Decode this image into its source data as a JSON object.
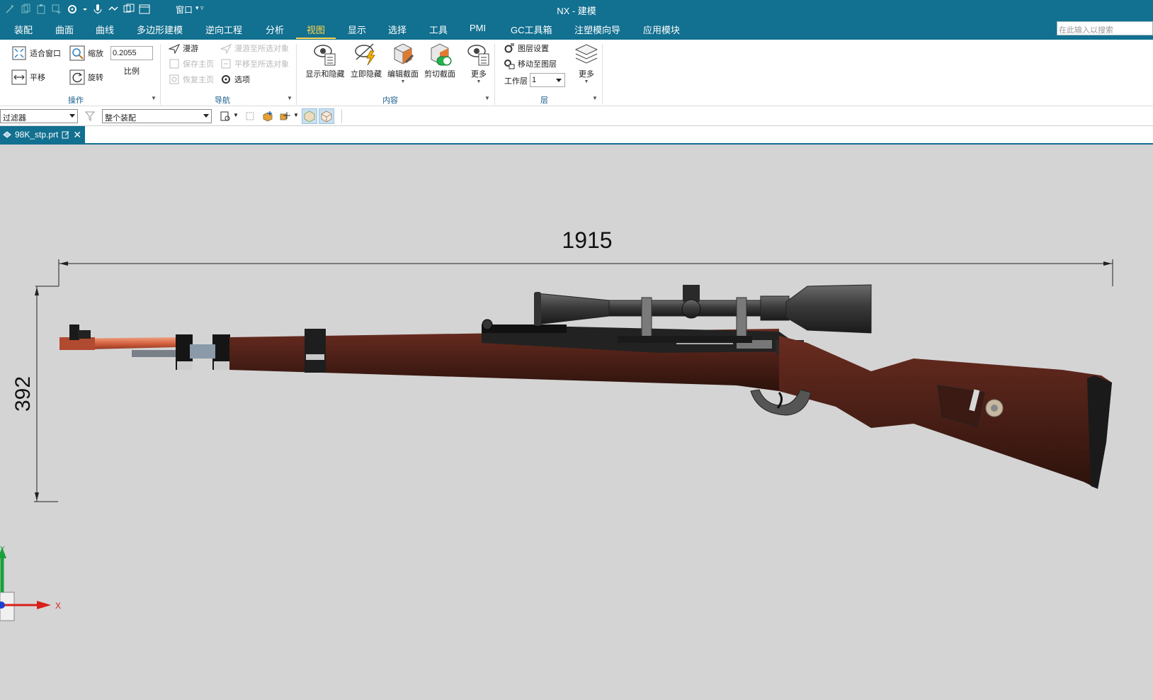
{
  "window": {
    "title": "NX - 建模",
    "window_menu_label": "窗口"
  },
  "menu": {
    "tabs": [
      "装配",
      "曲面",
      "曲线",
      "多边形建模",
      "逆向工程",
      "分析",
      "视图",
      "显示",
      "选择",
      "工具",
      "PMI",
      "GC工具箱",
      "注塑模向导",
      "应用模块"
    ],
    "active_tab": "视图",
    "search_placeholder": "在此输入以搜索"
  },
  "ribbon": {
    "operate": {
      "fit_window": "适合窗口",
      "zoom": "缩放",
      "scale_value": "0.2055",
      "scale_label": "比例",
      "pan": "平移",
      "rotate": "旋转",
      "group_label": "操作"
    },
    "navigate": {
      "fly": "漫游",
      "fly_to_selected": "漫游至所选对象",
      "save_home": "保存主页",
      "pan_to_selected": "平移至所选对象",
      "restore_home": "恢复主页",
      "options": "选项",
      "group_label": "导航"
    },
    "content": {
      "show_hide": "显示和隐藏",
      "immediate_hide": "立即隐藏",
      "edit_section": "编辑截面",
      "clip_section": "剪切截面",
      "more": "更多",
      "group_label": "内容"
    },
    "layer": {
      "layer_settings": "图层设置",
      "move_to_layer": "移动至图层",
      "work_layer_label": "工作层",
      "work_layer_value": "1",
      "more": "更多",
      "group_label": "层"
    }
  },
  "selection_bar": {
    "filter": "过滤器",
    "scope": "整个装配"
  },
  "document": {
    "tab_name": "98K_stp.prt"
  },
  "graphics": {
    "dimension_horizontal": "1915",
    "dimension_vertical": "392",
    "axis_x": "X",
    "axis_y": "Y"
  },
  "colors": {
    "title_bar": "#127090",
    "active_tab": "#ffd34d",
    "background": "#d4d4d4",
    "wood": "#4a1f16",
    "scope_metal": "#3c3c3c"
  }
}
